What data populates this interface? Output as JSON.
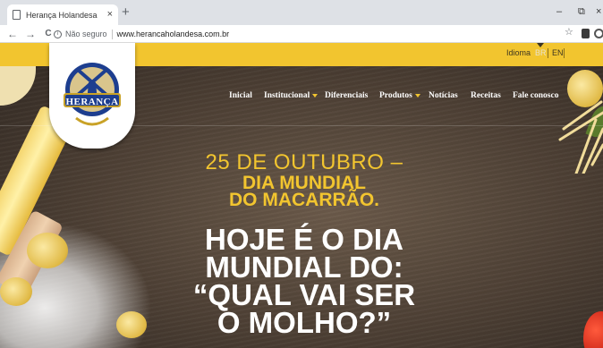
{
  "browser": {
    "tab_title": "Herança Holandesa",
    "tab_close": "×",
    "new_tab": "+",
    "window_controls": {
      "minimize": "–",
      "restore": "⧉",
      "close": "×"
    },
    "nav": {
      "back": "←",
      "forward": "→",
      "reload": "C"
    },
    "security_label": "Não seguro",
    "url": "www.herancaholandesa.com.br",
    "bookmark_star": "☆"
  },
  "site": {
    "language": {
      "label": "Idioma",
      "options": [
        "BR",
        "EN"
      ],
      "selected": "BR"
    },
    "logo_text": "HERANÇA",
    "menu": [
      {
        "label": "Inicial",
        "has_dropdown": false
      },
      {
        "label": "Institucional",
        "has_dropdown": true
      },
      {
        "label": "Diferenciais",
        "has_dropdown": false
      },
      {
        "label": "Produtos",
        "has_dropdown": true
      },
      {
        "label": "Notícias",
        "has_dropdown": false
      },
      {
        "label": "Receitas",
        "has_dropdown": false
      },
      {
        "label": "Fale conosco",
        "has_dropdown": false
      }
    ],
    "hero": {
      "date": "25 DE OUTUBRO –",
      "subtitle_lines": [
        "DIA MUNDIAL",
        "DO MACARRÃO."
      ],
      "headline_lines": [
        "HOJE É O DIA",
        "MUNDIAL DO:",
        "“QUAL VAI SER",
        "O MOLHO?”"
      ]
    }
  },
  "colors": {
    "brand_yellow": "#f2c52f",
    "background_dark": "#4b3e33",
    "headline_white": "#ffffff",
    "logo_blue": "#1d3e8f"
  }
}
